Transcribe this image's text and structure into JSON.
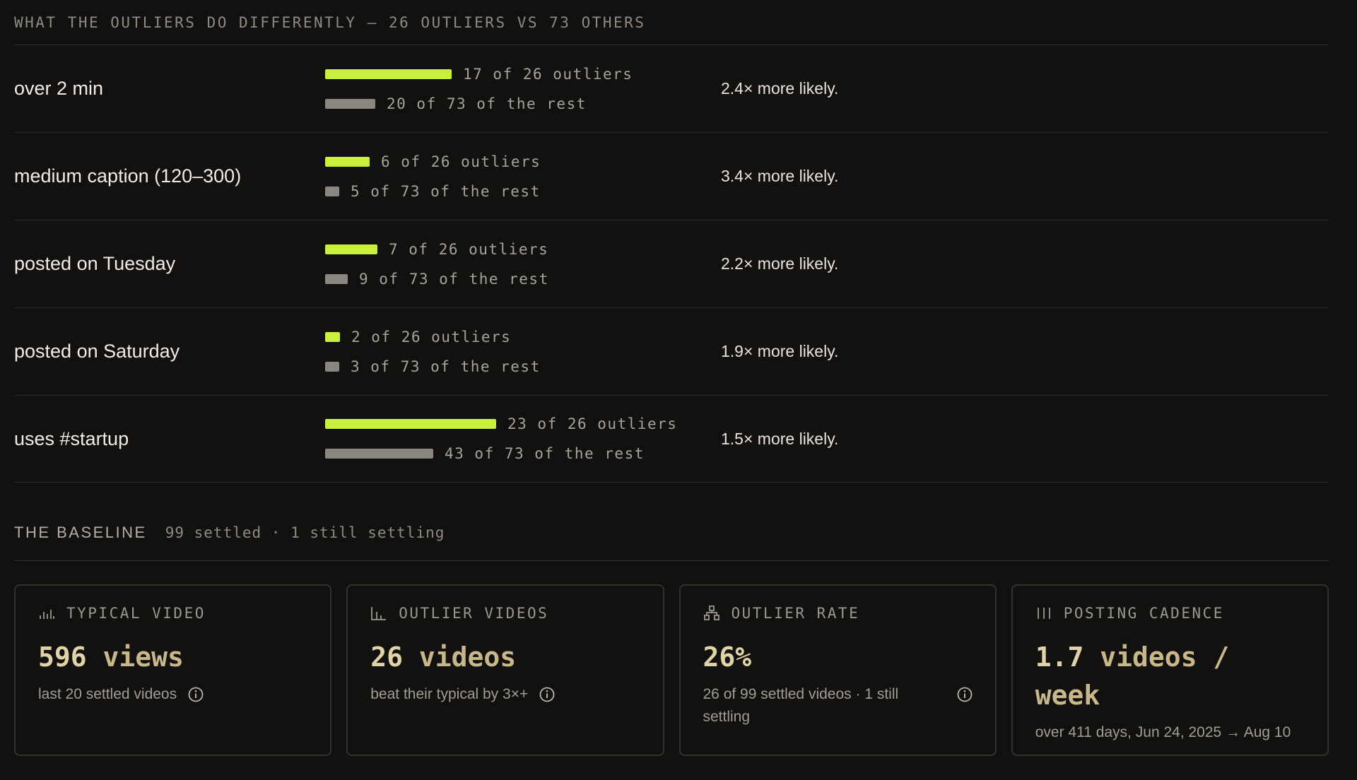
{
  "comparison": {
    "title": "WHAT THE OUTLIERS DO DIFFERENTLY — 26 OUTLIERS VS 73 OTHERS",
    "outlier_color": "#c8f03c",
    "rest_color": "#8a8780",
    "rows": [
      {
        "label": "over 2 min",
        "outlier_text": "17 of 26 outliers",
        "outlier_count": 17,
        "outlier_total": 26,
        "rest_text": "20 of 73 of the rest",
        "rest_count": 20,
        "rest_total": 73,
        "likely": "2.4× more likely."
      },
      {
        "label": "medium caption (120–300)",
        "outlier_text": "6 of 26 outliers",
        "outlier_count": 6,
        "outlier_total": 26,
        "rest_text": "5 of 73 of the rest",
        "rest_count": 5,
        "rest_total": 73,
        "likely": "3.4× more likely."
      },
      {
        "label": "posted on Tuesday",
        "outlier_text": "7 of 26 outliers",
        "outlier_count": 7,
        "outlier_total": 26,
        "rest_text": "9 of 73 of the rest",
        "rest_count": 9,
        "rest_total": 73,
        "likely": "2.2× more likely."
      },
      {
        "label": "posted on Saturday",
        "outlier_text": "2 of 26 outliers",
        "outlier_count": 2,
        "outlier_total": 26,
        "rest_text": "3 of 73 of the rest",
        "rest_count": 3,
        "rest_total": 73,
        "likely": "1.9× more likely."
      },
      {
        "label": "uses #startup",
        "outlier_text": "23 of 26 outliers",
        "outlier_count": 23,
        "outlier_total": 26,
        "rest_text": "43 of 73 of the rest",
        "rest_count": 43,
        "rest_total": 73,
        "likely": "1.5× more likely."
      }
    ]
  },
  "baseline": {
    "title": "THE BASELINE",
    "subtitle": "99 settled · 1 still settling"
  },
  "cards": [
    {
      "icon": "bar-chart-icon",
      "label": "TYPICAL VIDEO",
      "value_num": "596",
      "value_unit": " views",
      "note": "last 20 settled videos",
      "has_info": true
    },
    {
      "icon": "axis-chart-icon",
      "label": "OUTLIER VIDEOS",
      "value_num": "26",
      "value_unit": " videos",
      "note": "beat their typical by 3×+",
      "has_info": true
    },
    {
      "icon": "network-icon",
      "label": "OUTLIER RATE",
      "value_num": "26%",
      "value_unit": "",
      "note": "26 of 99 settled videos · 1 still settling",
      "has_info": true
    },
    {
      "icon": "columns-icon",
      "label": "POSTING CADENCE",
      "value_num": "1.7",
      "value_unit": " videos / week",
      "note": "over 411 days, Jun 24, 2025 → Aug 10",
      "has_info": false
    }
  ]
}
